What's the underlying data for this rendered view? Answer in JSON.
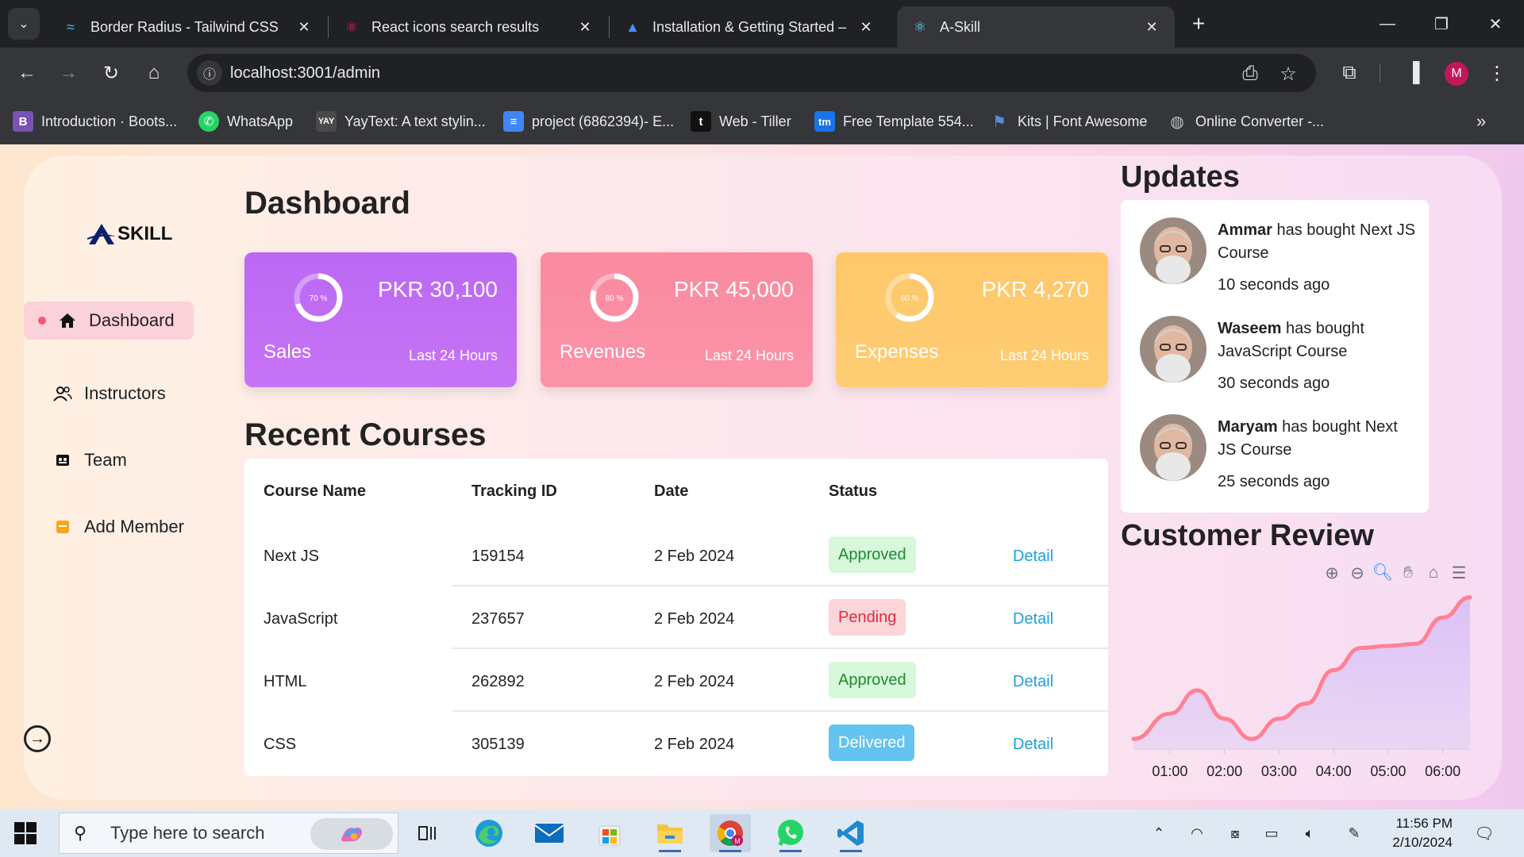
{
  "browser": {
    "tabs": [
      {
        "title": "Border Radius - Tailwind CSS",
        "icon": "tailwind-icon"
      },
      {
        "title": "React icons search results",
        "icon": "react-icons-icon"
      },
      {
        "title": "Installation & Getting Started –",
        "icon": "tiller-icon"
      },
      {
        "title": "A-Skill",
        "icon": "react-icon",
        "active": true
      }
    ],
    "url": "localhost:3001/admin",
    "profile_initial": "M",
    "bookmarks": [
      {
        "label": "Introduction · Boots...",
        "icon": "bootstrap-icon",
        "color": "#7952b3",
        "glyph": "B"
      },
      {
        "label": "WhatsApp",
        "icon": "whatsapp-icon",
        "color": "#25d366",
        "glyph": "✆"
      },
      {
        "label": "YayText: A text stylin...",
        "icon": "yaytext-icon",
        "color": "#4a4a4a",
        "glyph": "Y"
      },
      {
        "label": "project (6862394)- E...",
        "icon": "document-icon",
        "color": "#4285f4",
        "glyph": "≡"
      },
      {
        "label": "Web - Tiller",
        "icon": "tiller-t-icon",
        "color": "#111111",
        "glyph": "t"
      },
      {
        "label": "Free Template 554...",
        "icon": "tm-icon",
        "color": "#1a73e8",
        "glyph": "tm"
      },
      {
        "label": "Kits | Font Awesome",
        "icon": "flag-icon",
        "color": "#538dd7",
        "glyph": "⚑"
      },
      {
        "label": "Online Converter -...",
        "icon": "globe-icon",
        "color": "#5f6368",
        "glyph": "◍"
      }
    ]
  },
  "app": {
    "logo_text": "SKILL",
    "sidebar": [
      {
        "label": "Dashboard",
        "icon": "home-icon",
        "glyph": "⌂",
        "active": true
      },
      {
        "label": "Instructors",
        "icon": "users-icon",
        "glyph": "👥"
      },
      {
        "label": "Team",
        "icon": "team-icon",
        "glyph": "👪"
      },
      {
        "label": "Add Member",
        "icon": "add-member-icon",
        "glyph": "▬"
      }
    ],
    "dashboard_title": "Dashboard",
    "stats": [
      {
        "label": "Sales",
        "amount": "PKR 30,100",
        "sub": "Last 24 Hours",
        "percent_label": "70 %",
        "percent": 0.7,
        "color": "#c06af2"
      },
      {
        "label": "Revenues",
        "amount": "PKR 45,000",
        "sub": "Last 24 Hours",
        "percent_label": "80 %",
        "percent": 0.8,
        "color": "#fa8ca3"
      },
      {
        "label": "Expenses",
        "amount": "PKR 4,270",
        "sub": "Last 24 Hours",
        "percent_label": "60 %",
        "percent": 0.6,
        "color": "#fec96d"
      }
    ],
    "recent_courses_title": "Recent Courses",
    "table": {
      "headers": [
        "Course Name",
        "Tracking ID",
        "Date",
        "Status"
      ],
      "rows": [
        {
          "course": "Next JS",
          "id": "159154",
          "date": "2 Feb 2024",
          "status": "Approved",
          "status_bg": "#d7f8da",
          "status_fg": "#1f8a32",
          "action": "Detail"
        },
        {
          "course": "JavaScript",
          "id": "237657",
          "date": "2 Feb 2024",
          "status": "Pending",
          "status_bg": "#fcd5d9",
          "status_fg": "#e02b3e",
          "action": "Detail"
        },
        {
          "course": "HTML",
          "id": "262892",
          "date": "2 Feb 2024",
          "status": "Approved",
          "status_bg": "#d7f8da",
          "status_fg": "#1f8a32",
          "action": "Detail"
        },
        {
          "course": "CSS",
          "id": "305139",
          "date": "2 Feb 2024",
          "status": "Delivered",
          "status_bg": "#64c3ef",
          "status_fg": "#ffffff",
          "action": "Detail"
        }
      ]
    },
    "updates_title": "Updates",
    "updates": [
      {
        "name": "Ammar",
        "text": " has bought Next JS Course",
        "time": "10 seconds ago"
      },
      {
        "name": "Waseem",
        "text": " has bought JavaScript Course",
        "time": "30 seconds ago"
      },
      {
        "name": "Maryam",
        "text": " has bought Next JS Course",
        "time": "25 seconds ago"
      }
    ],
    "review_title": "Customer Review",
    "chart_tools": [
      "zoom-in-icon",
      "zoom-out-icon",
      "magnifier-icon",
      "pan-hand-icon",
      "reset-home-icon",
      "menu-icon"
    ]
  },
  "chart_data": {
    "type": "area",
    "title": "",
    "x": [
      "00:20",
      "01:00",
      "01:30",
      "02:00",
      "02:30",
      "03:00",
      "03:30",
      "04:00",
      "04:30",
      "05:00",
      "05:30",
      "06:00",
      "06:30"
    ],
    "tick_labels": [
      "01:00",
      "02:00",
      "03:00",
      "04:00",
      "05:00",
      "06:00"
    ],
    "series": [
      {
        "values": [
          10,
          35,
          58,
          30,
          10,
          30,
          45,
          78,
          100,
          102,
          104,
          130,
          150
        ],
        "color": "#ff8195"
      }
    ],
    "ylim": [
      0,
      160
    ],
    "grid": false,
    "legend": "none"
  },
  "taskbar": {
    "search_placeholder": "Type here to search",
    "time": "11:56 PM",
    "date": "2/10/2024",
    "apps": [
      "task-view-icon",
      "edge-icon",
      "mail-icon",
      "store-icon",
      "file-explorer-icon",
      "chrome-icon",
      "whatsapp-icon",
      "vscode-icon"
    ]
  }
}
